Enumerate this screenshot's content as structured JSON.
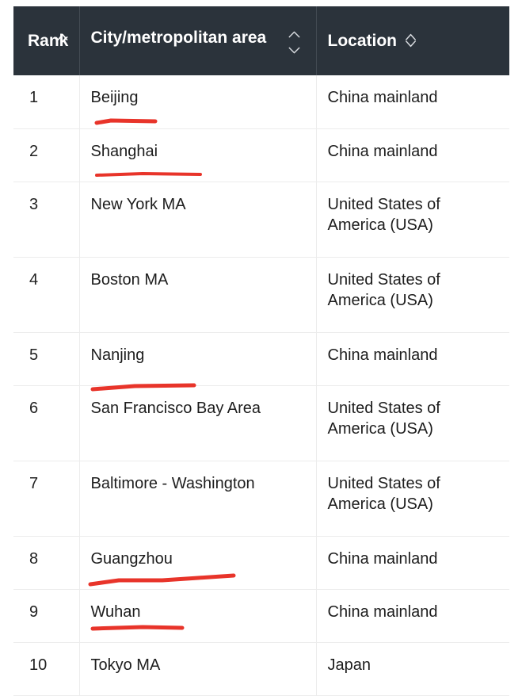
{
  "table": {
    "columns": [
      {
        "key": "rank",
        "label": "Rank",
        "sort_icon": "sort-caret-up-icon"
      },
      {
        "key": "city",
        "label": "City/metropolitan area",
        "sort_icon": "sort-caret-updown-icon"
      },
      {
        "key": "location",
        "label": "Location",
        "sort_icon": "sort-diamond-icon"
      }
    ],
    "rows": [
      {
        "rank": "1",
        "city": "Beijing",
        "location": "China mainland"
      },
      {
        "rank": "2",
        "city": "Shanghai",
        "location": "China mainland"
      },
      {
        "rank": "3",
        "city": "New York MA",
        "location": "United States of America (USA)"
      },
      {
        "rank": "4",
        "city": "Boston MA",
        "location": "United States of America (USA)"
      },
      {
        "rank": "5",
        "city": "Nanjing",
        "location": "China mainland"
      },
      {
        "rank": "6",
        "city": "San Francisco Bay Area",
        "location": "United States of America (USA)"
      },
      {
        "rank": "7",
        "city": "Baltimore - Washington",
        "location": "United States of America (USA)"
      },
      {
        "rank": "8",
        "city": "Guangzhou",
        "location": "China mainland"
      },
      {
        "rank": "9",
        "city": "Wuhan",
        "location": "China mainland"
      },
      {
        "rank": "10",
        "city": "Tokyo MA",
        "location": "Japan"
      }
    ]
  },
  "annotations": {
    "color": "#e8342a",
    "underlined_cities": [
      "Beijing",
      "Shanghai",
      "Nanjing",
      "Guangzhou",
      "Wuhan"
    ]
  },
  "colors": {
    "header_background": "#2b333b",
    "header_text": "#ffffff",
    "body_text": "#1d1d1d",
    "row_border": "#ececec",
    "annotation_red": "#e8342a",
    "page_background": "#ffffff"
  }
}
